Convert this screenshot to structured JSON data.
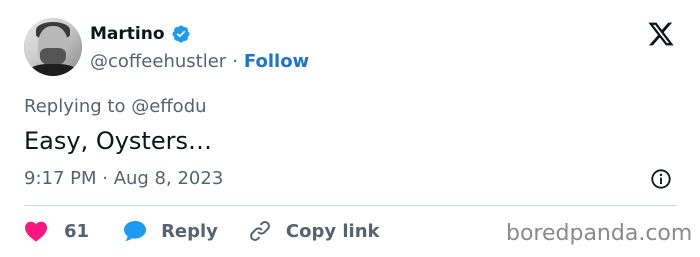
{
  "author": {
    "name": "Martino",
    "handle": "@coffeehustler",
    "separator": "·",
    "follow_label": "Follow"
  },
  "tweet": {
    "replying_to": "Replying to @effodu",
    "text": "Easy, Oysters…",
    "timestamp": "9:17 PM · Aug 8, 2023"
  },
  "actions": {
    "like_count": "61",
    "reply_label": "Reply",
    "copy_link_label": "Copy link"
  },
  "watermark": "boredpanda.com",
  "colors": {
    "like": "#f91880",
    "reply": "#1d9bf0",
    "verified": "#1d9bf0",
    "follow": "#1d74c8",
    "secondary_text": "#536471"
  },
  "icons": {
    "verified": "verified-badge-icon",
    "brand": "x-logo-icon",
    "info": "info-icon",
    "like": "heart-icon",
    "reply": "speech-bubble-icon",
    "copy": "link-icon"
  }
}
